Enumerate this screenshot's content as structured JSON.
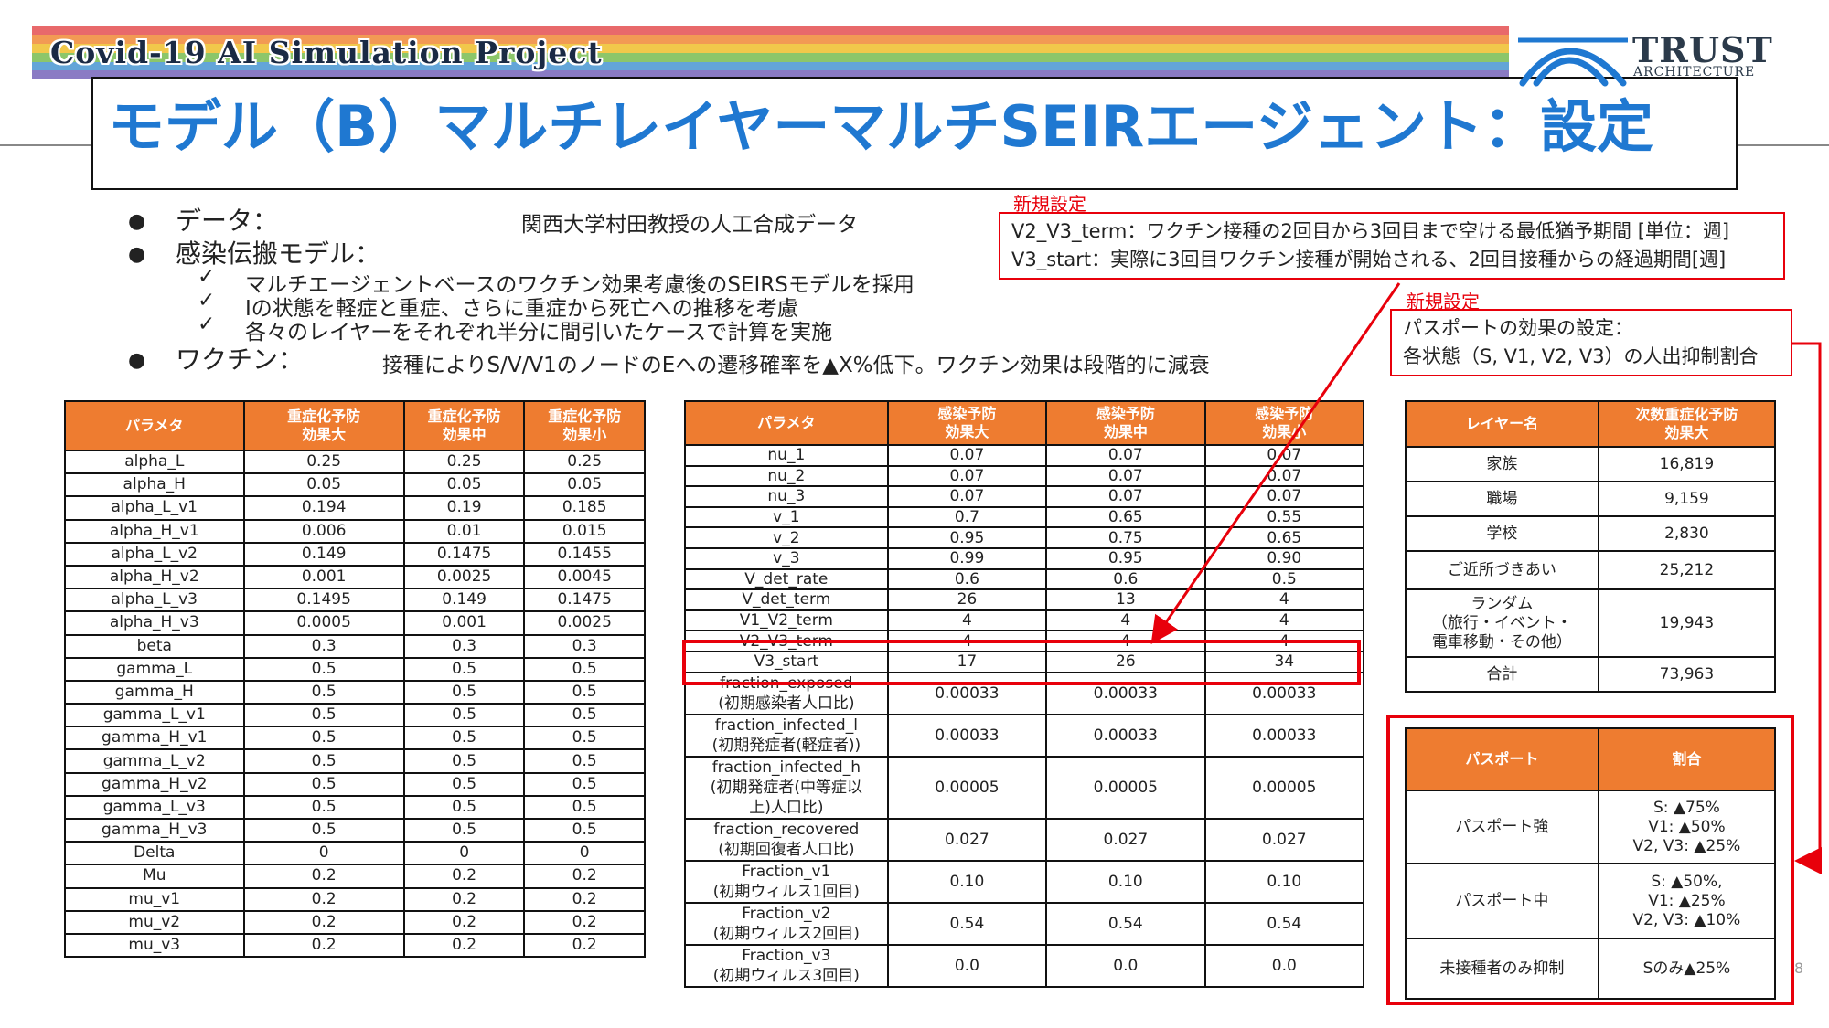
{
  "header": {
    "project_title": "Covid-19 AI Simulation Project",
    "slide_title": "モデル（B）マルチレイヤーマルチSEIRエージェント：設定",
    "logo_main": "TRUST",
    "logo_sub": "ARCHITECTURE",
    "rainbow_colors": [
      "#e8696b",
      "#f29a54",
      "#f1c84b",
      "#8cc66a",
      "#63a5d8",
      "#8a7bc4"
    ]
  },
  "bullets": {
    "data_label": "データ：",
    "data_value": "関西大学村田教授の人工合成データ",
    "model_label": "感染伝搬モデル：",
    "model_items": [
      "マルチエージェントベースのワクチン効果考慮後のSEIRSモデルを採用",
      "Iの状態を軽症と重症、さらに重症から死亡への推移を考慮",
      "各々のレイヤーをそれぞれ半分に間引いたケースで計算を実施"
    ],
    "vaccine_label": "ワクチン：",
    "vaccine_value": "接種によりS/V/V1のノードのEへの遷移確率を▲X%低下。ワクチン効果は段階的に減衰",
    "bullet_glyph": "●",
    "check_glyph": "✓"
  },
  "notes": {
    "note1_label": "新規設定",
    "note1_lines": [
      "V2_V3_term：ワクチン接種の2回目から3回目まで空ける最低猶予期間 [単位：週]",
      "V3_start：実際に3回目ワクチン接種が開始される、2回目接種からの経過期間[週]"
    ],
    "note2_label": "新規設定",
    "note2_lines": [
      "パスポートの効果の設定：",
      "各状態（S, V1, V2, V3）の人出抑制割合"
    ],
    "accent_color": "#e8000b"
  },
  "table1": {
    "headers": [
      "パラメタ",
      "重症化予防\n効果大",
      "重症化予防\n効果中",
      "重症化予防\n効果小"
    ],
    "rows": [
      [
        "alpha_L",
        "0.25",
        "0.25",
        "0.25"
      ],
      [
        "alpha_H",
        "0.05",
        "0.05",
        "0.05"
      ],
      [
        "alpha_L_v1",
        "0.194",
        "0.19",
        "0.185"
      ],
      [
        "alpha_H_v1",
        "0.006",
        "0.01",
        "0.015"
      ],
      [
        "alpha_L_v2",
        "0.149",
        "0.1475",
        "0.1455"
      ],
      [
        "alpha_H_v2",
        "0.001",
        "0.0025",
        "0.0045"
      ],
      [
        "alpha_L_v3",
        "0.1495",
        "0.149",
        "0.1475"
      ],
      [
        "alpha_H_v3",
        "0.0005",
        "0.001",
        "0.0025"
      ],
      [
        "beta",
        "0.3",
        "0.3",
        "0.3"
      ],
      [
        "gamma_L",
        "0.5",
        "0.5",
        "0.5"
      ],
      [
        "gamma_H",
        "0.5",
        "0.5",
        "0.5"
      ],
      [
        "gamma_L_v1",
        "0.5",
        "0.5",
        "0.5"
      ],
      [
        "gamma_H_v1",
        "0.5",
        "0.5",
        "0.5"
      ],
      [
        "gamma_L_v2",
        "0.5",
        "0.5",
        "0.5"
      ],
      [
        "gamma_H_v2",
        "0.5",
        "0.5",
        "0.5"
      ],
      [
        "gamma_L_v3",
        "0.5",
        "0.5",
        "0.5"
      ],
      [
        "gamma_H_v3",
        "0.5",
        "0.5",
        "0.5"
      ],
      [
        "Delta",
        "0",
        "0",
        "0"
      ],
      [
        "Mu",
        "0.2",
        "0.2",
        "0.2"
      ],
      [
        "mu_v1",
        "0.2",
        "0.2",
        "0.2"
      ],
      [
        "mu_v2",
        "0.2",
        "0.2",
        "0.2"
      ],
      [
        "mu_v3",
        "0.2",
        "0.2",
        "0.2"
      ]
    ]
  },
  "table2": {
    "headers": [
      "パラメタ",
      "感染予防\n効果大",
      "感染予防\n効果中",
      "感染予防\n効果小"
    ],
    "rows": [
      [
        "nu_1",
        "0.07",
        "0.07",
        "0.07"
      ],
      [
        "nu_2",
        "0.07",
        "0.07",
        "0.07"
      ],
      [
        "nu_3",
        "0.07",
        "0.07",
        "0.07"
      ],
      [
        "v_1",
        "0.7",
        "0.65",
        "0.55"
      ],
      [
        "v_2",
        "0.95",
        "0.75",
        "0.65"
      ],
      [
        "v_3",
        "0.99",
        "0.95",
        "0.90"
      ],
      [
        "V_det_rate",
        "0.6",
        "0.6",
        "0.5"
      ],
      [
        "V_det_term",
        "26",
        "13",
        "4"
      ],
      [
        "V1_V2_term",
        "4",
        "4",
        "4"
      ],
      [
        "V2_V3_term",
        "4",
        "4",
        "4"
      ],
      [
        "V3_start",
        "17",
        "26",
        "34"
      ]
    ],
    "tall_rows": [
      [
        "fraction_exposed\n(初期感染者人口比)",
        "0.00033",
        "0.00033",
        "0.00033"
      ],
      [
        "fraction_infected_l\n(初期発症者(軽症者))",
        "0.00033",
        "0.00033",
        "0.00033"
      ],
      [
        "fraction_infected_h\n(初期発症者(中等症以\n上)人口比)",
        "0.00005",
        "0.00005",
        "0.00005"
      ],
      [
        "fraction_recovered\n(初期回復者人口比)",
        "0.027",
        "0.027",
        "0.027"
      ],
      [
        "Fraction_v1\n(初期ウィルス1回目)",
        "0.10",
        "0.10",
        "0.10"
      ],
      [
        "Fraction_v2\n(初期ウィルス2回目)",
        "0.54",
        "0.54",
        "0.54"
      ],
      [
        "Fraction_v3\n(初期ウィルス3回目)",
        "0.0",
        "0.0",
        "0.0"
      ]
    ]
  },
  "table3": {
    "headers": [
      "レイヤー名",
      "次数重症化予防\n効果大"
    ],
    "rows": [
      [
        "家族",
        "16,819"
      ],
      [
        "職場",
        "9,159"
      ],
      [
        "学校",
        "2,830"
      ],
      [
        "ご近所づきあい",
        "25,212"
      ],
      [
        "ランダム\n（旅行・イベント・\n電車移動・その他）",
        "19,943"
      ],
      [
        "合計",
        "73,963"
      ]
    ]
  },
  "table4": {
    "headers": [
      "パスポート",
      "割合"
    ],
    "rows": [
      [
        "パスポート強",
        "S: ▲75%\nV1: ▲50%\nV2, V3: ▲25%"
      ],
      [
        "パスポート中",
        "S: ▲50%,\nV1: ▲25%\nV2, V3: ▲10%"
      ],
      [
        "未接種者のみ抑制",
        "Sのみ▲25%"
      ]
    ]
  },
  "page_number": "8"
}
